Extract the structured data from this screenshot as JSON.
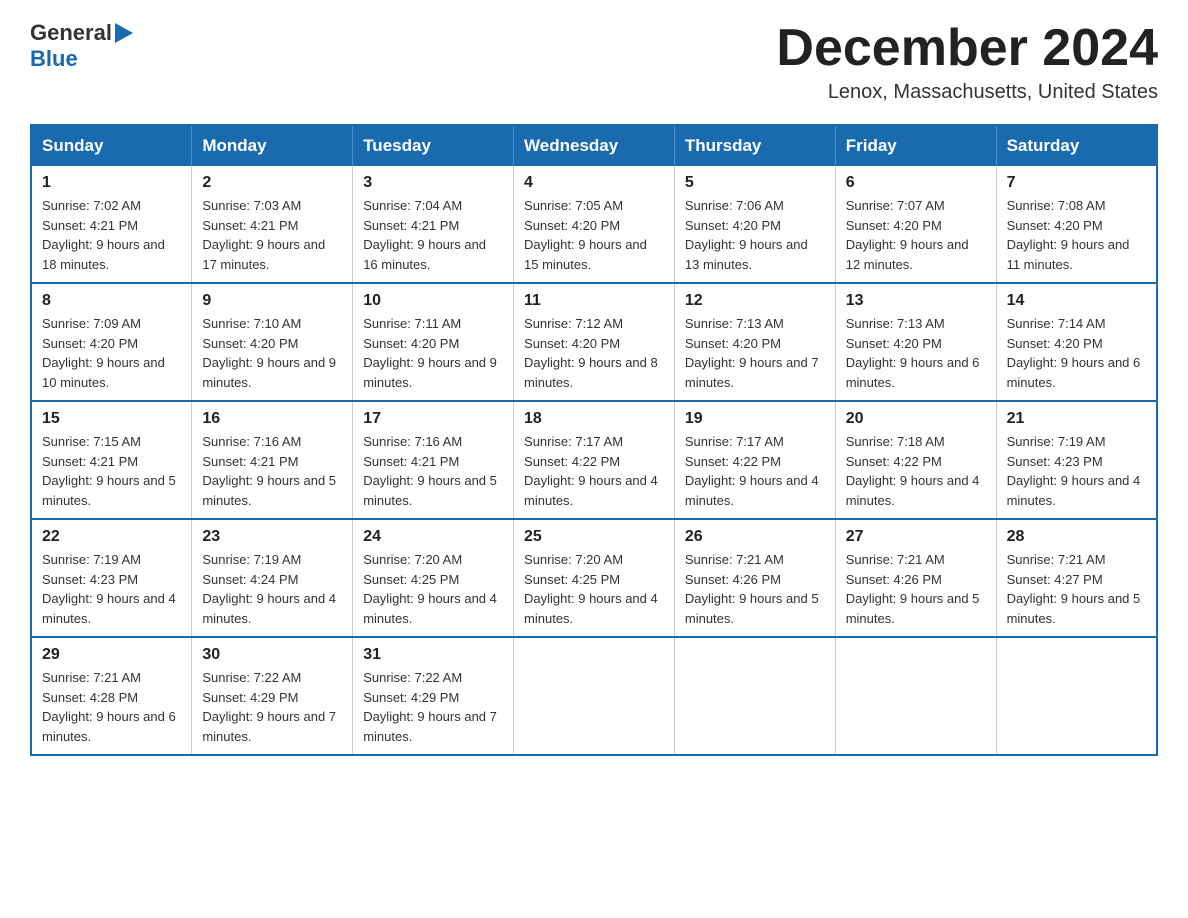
{
  "header": {
    "logo_general": "General",
    "logo_blue": "Blue",
    "month_title": "December 2024",
    "location": "Lenox, Massachusetts, United States"
  },
  "calendar": {
    "days_of_week": [
      "Sunday",
      "Monday",
      "Tuesday",
      "Wednesday",
      "Thursday",
      "Friday",
      "Saturday"
    ],
    "weeks": [
      [
        {
          "day": "1",
          "sunrise": "7:02 AM",
          "sunset": "4:21 PM",
          "daylight": "9 hours and 18 minutes."
        },
        {
          "day": "2",
          "sunrise": "7:03 AM",
          "sunset": "4:21 PM",
          "daylight": "9 hours and 17 minutes."
        },
        {
          "day": "3",
          "sunrise": "7:04 AM",
          "sunset": "4:21 PM",
          "daylight": "9 hours and 16 minutes."
        },
        {
          "day": "4",
          "sunrise": "7:05 AM",
          "sunset": "4:20 PM",
          "daylight": "9 hours and 15 minutes."
        },
        {
          "day": "5",
          "sunrise": "7:06 AM",
          "sunset": "4:20 PM",
          "daylight": "9 hours and 13 minutes."
        },
        {
          "day": "6",
          "sunrise": "7:07 AM",
          "sunset": "4:20 PM",
          "daylight": "9 hours and 12 minutes."
        },
        {
          "day": "7",
          "sunrise": "7:08 AM",
          "sunset": "4:20 PM",
          "daylight": "9 hours and 11 minutes."
        }
      ],
      [
        {
          "day": "8",
          "sunrise": "7:09 AM",
          "sunset": "4:20 PM",
          "daylight": "9 hours and 10 minutes."
        },
        {
          "day": "9",
          "sunrise": "7:10 AM",
          "sunset": "4:20 PM",
          "daylight": "9 hours and 9 minutes."
        },
        {
          "day": "10",
          "sunrise": "7:11 AM",
          "sunset": "4:20 PM",
          "daylight": "9 hours and 9 minutes."
        },
        {
          "day": "11",
          "sunrise": "7:12 AM",
          "sunset": "4:20 PM",
          "daylight": "9 hours and 8 minutes."
        },
        {
          "day": "12",
          "sunrise": "7:13 AM",
          "sunset": "4:20 PM",
          "daylight": "9 hours and 7 minutes."
        },
        {
          "day": "13",
          "sunrise": "7:13 AM",
          "sunset": "4:20 PM",
          "daylight": "9 hours and 6 minutes."
        },
        {
          "day": "14",
          "sunrise": "7:14 AM",
          "sunset": "4:20 PM",
          "daylight": "9 hours and 6 minutes."
        }
      ],
      [
        {
          "day": "15",
          "sunrise": "7:15 AM",
          "sunset": "4:21 PM",
          "daylight": "9 hours and 5 minutes."
        },
        {
          "day": "16",
          "sunrise": "7:16 AM",
          "sunset": "4:21 PM",
          "daylight": "9 hours and 5 minutes."
        },
        {
          "day": "17",
          "sunrise": "7:16 AM",
          "sunset": "4:21 PM",
          "daylight": "9 hours and 5 minutes."
        },
        {
          "day": "18",
          "sunrise": "7:17 AM",
          "sunset": "4:22 PM",
          "daylight": "9 hours and 4 minutes."
        },
        {
          "day": "19",
          "sunrise": "7:17 AM",
          "sunset": "4:22 PM",
          "daylight": "9 hours and 4 minutes."
        },
        {
          "day": "20",
          "sunrise": "7:18 AM",
          "sunset": "4:22 PM",
          "daylight": "9 hours and 4 minutes."
        },
        {
          "day": "21",
          "sunrise": "7:19 AM",
          "sunset": "4:23 PM",
          "daylight": "9 hours and 4 minutes."
        }
      ],
      [
        {
          "day": "22",
          "sunrise": "7:19 AM",
          "sunset": "4:23 PM",
          "daylight": "9 hours and 4 minutes."
        },
        {
          "day": "23",
          "sunrise": "7:19 AM",
          "sunset": "4:24 PM",
          "daylight": "9 hours and 4 minutes."
        },
        {
          "day": "24",
          "sunrise": "7:20 AM",
          "sunset": "4:25 PM",
          "daylight": "9 hours and 4 minutes."
        },
        {
          "day": "25",
          "sunrise": "7:20 AM",
          "sunset": "4:25 PM",
          "daylight": "9 hours and 4 minutes."
        },
        {
          "day": "26",
          "sunrise": "7:21 AM",
          "sunset": "4:26 PM",
          "daylight": "9 hours and 5 minutes."
        },
        {
          "day": "27",
          "sunrise": "7:21 AM",
          "sunset": "4:26 PM",
          "daylight": "9 hours and 5 minutes."
        },
        {
          "day": "28",
          "sunrise": "7:21 AM",
          "sunset": "4:27 PM",
          "daylight": "9 hours and 5 minutes."
        }
      ],
      [
        {
          "day": "29",
          "sunrise": "7:21 AM",
          "sunset": "4:28 PM",
          "daylight": "9 hours and 6 minutes."
        },
        {
          "day": "30",
          "sunrise": "7:22 AM",
          "sunset": "4:29 PM",
          "daylight": "9 hours and 7 minutes."
        },
        {
          "day": "31",
          "sunrise": "7:22 AM",
          "sunset": "4:29 PM",
          "daylight": "9 hours and 7 minutes."
        },
        null,
        null,
        null,
        null
      ]
    ]
  }
}
